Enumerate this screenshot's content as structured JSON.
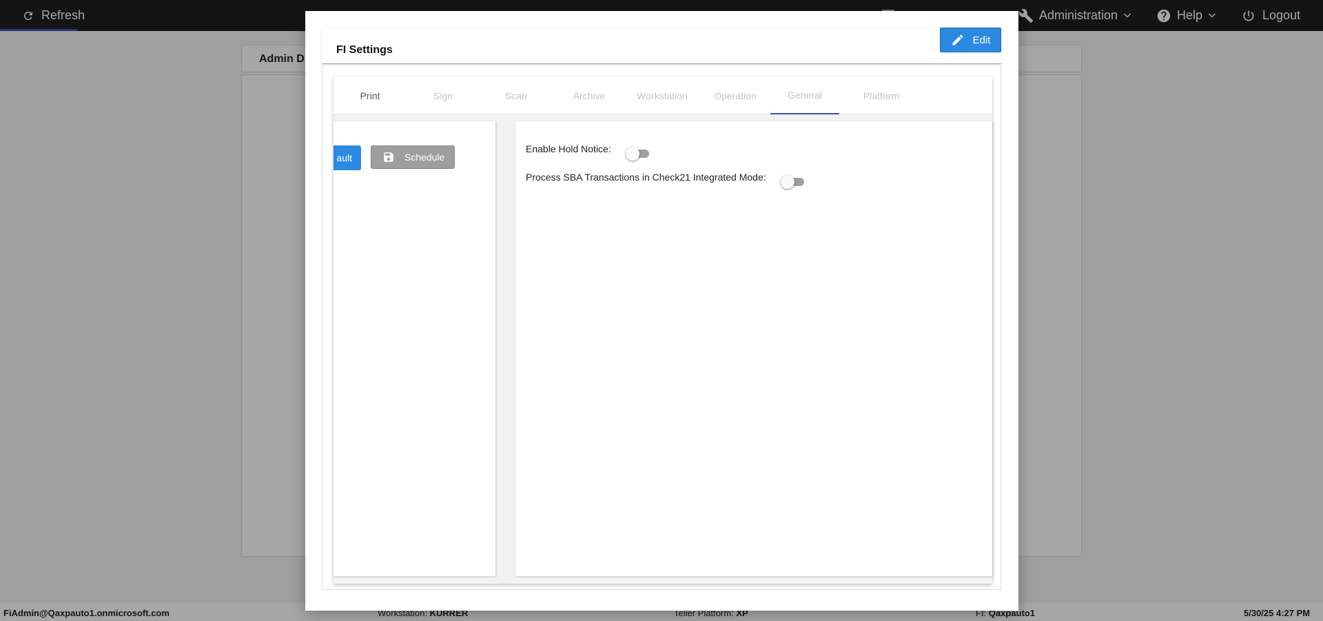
{
  "topbar": {
    "refresh_label": "Refresh",
    "administration_label": "Administration",
    "help_label": "Help",
    "logout_label": "Logout"
  },
  "background": {
    "header_title": "Admin D"
  },
  "statusbar": {
    "user": "FiAdmin@Qaxpauto1.onmicrosoft.com",
    "workstation_label": "Workstation:",
    "workstation_value": "KURRER",
    "platform_label": "Teller Platform:",
    "platform_value": "XP",
    "fi_label": "FI:",
    "fi_value": "Qaxpauto1",
    "datetime": "5/30/25 4:27 PM"
  },
  "modal": {
    "title": "FI Settings",
    "edit_label": "Edit",
    "tabs": [
      {
        "label": "Print",
        "state": "inactive"
      },
      {
        "label": "Sign",
        "state": "disabled"
      },
      {
        "label": "Scan",
        "state": "disabled"
      },
      {
        "label": "Archive",
        "state": "disabled"
      },
      {
        "label": "Workstation",
        "state": "disabled"
      },
      {
        "label": "Operation",
        "state": "disabled"
      },
      {
        "label": "General",
        "state": "active"
      },
      {
        "label": "Platform",
        "state": "disabled"
      }
    ],
    "left_buttons": {
      "default_label": "ault",
      "schedule_label": "Schedule"
    },
    "settings": [
      {
        "label": "Enable Hold Notice:",
        "enabled": false
      },
      {
        "label": "Process SBA Transactions in Check21 Integrated Mode:",
        "enabled": false
      }
    ]
  },
  "colors": {
    "primary_button": "#2b8ae0",
    "tab_indicator": "#3f51b5",
    "topbar": "#1f1f1f",
    "disabled_button": "#9e9e9e"
  },
  "icons": {
    "refresh": "refresh-icon",
    "administration": "wrench-icon",
    "help": "help-circle-icon",
    "logout": "power-icon",
    "edit": "pencil-icon",
    "schedule": "save-icon"
  }
}
